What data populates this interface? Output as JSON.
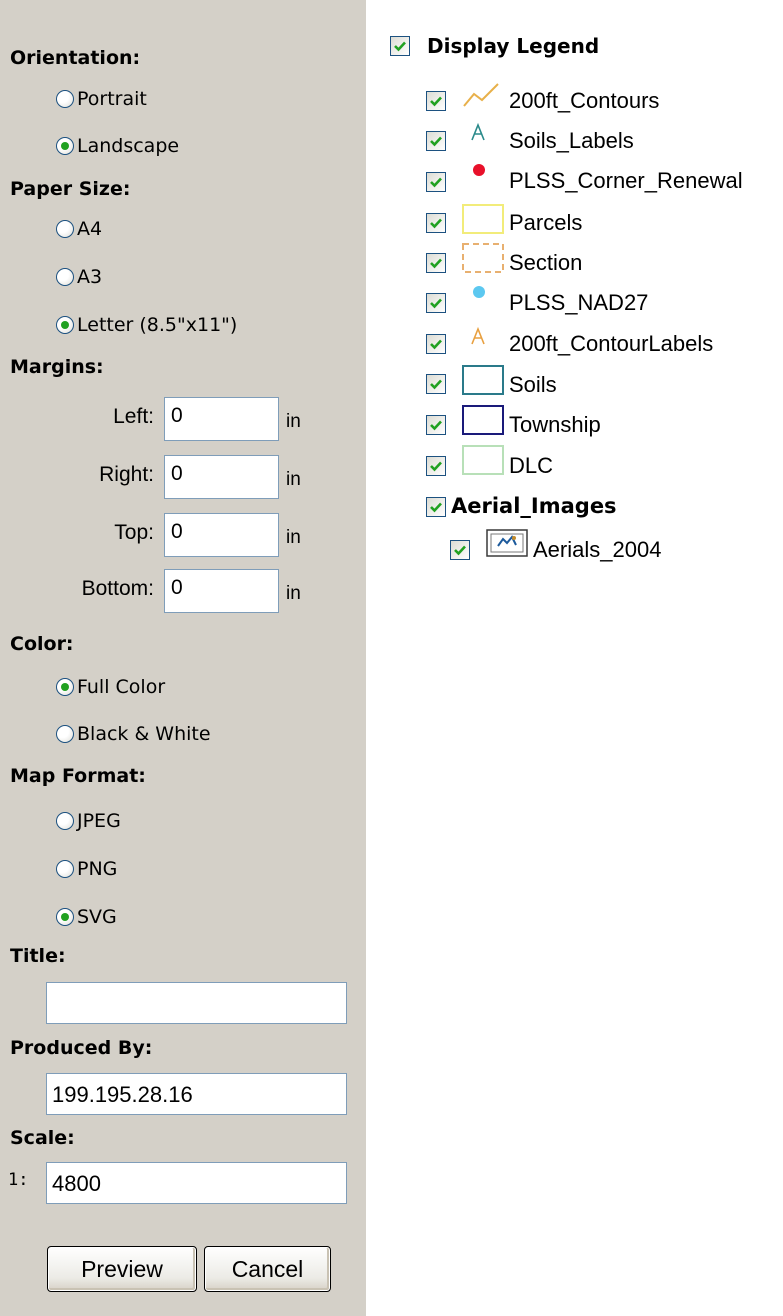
{
  "print_options": {
    "orientation": {
      "label": "Orientation:",
      "options": [
        {
          "label": "Portrait",
          "checked": false
        },
        {
          "label": "Landscape",
          "checked": true
        }
      ]
    },
    "paper_size": {
      "label": "Paper Size:",
      "options": [
        {
          "label": "A4",
          "checked": false
        },
        {
          "label": "A3",
          "checked": false
        },
        {
          "label": "Letter (8.5\"x11\")",
          "checked": true
        }
      ]
    },
    "margins": {
      "label": "Margins:",
      "unit": "in",
      "fields": [
        {
          "label": "Left:",
          "value": "0"
        },
        {
          "label": "Right:",
          "value": "0"
        },
        {
          "label": "Top:",
          "value": "0"
        },
        {
          "label": "Bottom:",
          "value": "0"
        }
      ]
    },
    "color": {
      "label": "Color:",
      "options": [
        {
          "label": "Full Color",
          "checked": true
        },
        {
          "label": "Black & White",
          "checked": false
        }
      ]
    },
    "map_format": {
      "label": "Map Format:",
      "options": [
        {
          "label": "JPEG",
          "checked": false
        },
        {
          "label": "PNG",
          "checked": false
        },
        {
          "label": "SVG",
          "checked": true
        }
      ]
    },
    "title": {
      "label": "Title:",
      "value": ""
    },
    "produced_by": {
      "label": "Produced By:",
      "value": "199.195.28.16"
    },
    "scale": {
      "label": "Scale:",
      "prefix": "1:",
      "value": "4800"
    },
    "buttons": {
      "preview": "Preview",
      "cancel": "Cancel"
    }
  },
  "legend": {
    "display_label": "Display Legend",
    "display_checked": true,
    "layers": [
      {
        "label": "200ft_Contours",
        "checked": true,
        "symbol": "line-icon",
        "color": "#e8b04a"
      },
      {
        "label": "Soils_Labels",
        "checked": true,
        "symbol": "text-a-icon",
        "color": "#2a8a8a"
      },
      {
        "label": "PLSS_Corner_Renewal",
        "checked": true,
        "symbol": "point-icon",
        "color": "#e8102a"
      },
      {
        "label": "Parcels",
        "checked": true,
        "symbol": "polygon-icon",
        "color": "#f2ec7a"
      },
      {
        "label": "Section",
        "checked": true,
        "symbol": "dashed-polygon-icon",
        "color": "#e8b070"
      },
      {
        "label": "PLSS_NAD27",
        "checked": true,
        "symbol": "point-icon",
        "color": "#5cc8f0"
      },
      {
        "label": "200ft_ContourLabels",
        "checked": true,
        "symbol": "text-a-icon",
        "color": "#e8a040"
      },
      {
        "label": "Soils",
        "checked": true,
        "symbol": "polygon-icon",
        "color": "#2a7a8a"
      },
      {
        "label": "Township",
        "checked": true,
        "symbol": "polygon-icon",
        "color": "#1a1a7a"
      },
      {
        "label": "DLC",
        "checked": true,
        "symbol": "polygon-icon",
        "color": "#b8e0b8"
      }
    ],
    "group": {
      "label": "Aerial_Images",
      "checked": true,
      "layers": [
        {
          "label": "Aerials_2004",
          "checked": true,
          "symbol": "raster-icon"
        }
      ]
    }
  }
}
